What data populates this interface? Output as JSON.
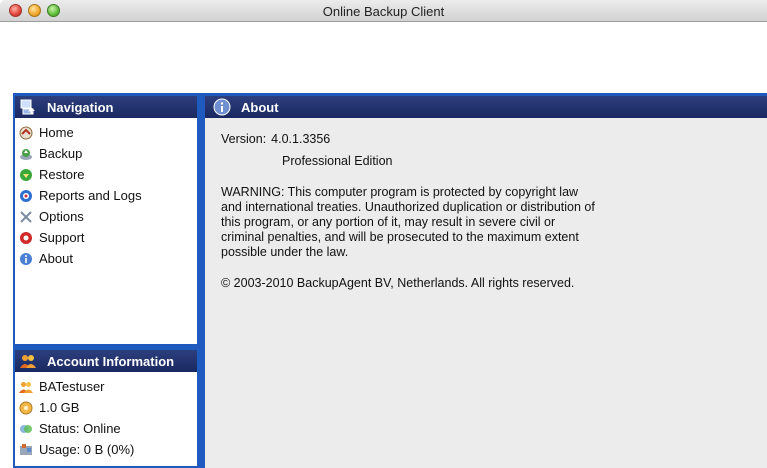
{
  "window": {
    "title": "Online Backup Client"
  },
  "navigation": {
    "header": "Navigation",
    "items": [
      {
        "label": "Home",
        "icon": "home-icon"
      },
      {
        "label": "Backup",
        "icon": "backup-icon"
      },
      {
        "label": "Restore",
        "icon": "restore-icon"
      },
      {
        "label": "Reports and Logs",
        "icon": "reports-icon"
      },
      {
        "label": "Options",
        "icon": "options-icon"
      },
      {
        "label": "Support",
        "icon": "support-icon"
      },
      {
        "label": "About",
        "icon": "info-icon"
      }
    ]
  },
  "account": {
    "header": "Account Information",
    "username": "BATestuser",
    "quota": "1.0 GB",
    "status": "Status: Online",
    "usage": "Usage: 0 B (0%)"
  },
  "about": {
    "header": "About",
    "version_label": "Version:",
    "version_value": "4.0.1.3356",
    "edition": "Professional Edition",
    "warning_lines": [
      "WARNING: This computer program is protected by copyright law",
      "and international treaties. Unauthorized duplication or distribution of",
      "this program, or any portion of it, may result in severe civil or",
      "criminal penalties, and will be prosecuted to the maximum extent",
      "possible under the law."
    ],
    "copyright": "© 2003-2010 BackupAgent BV, Netherlands. All rights reserved."
  },
  "colors": {
    "frame_blue": "#1f5bbf",
    "header_navy": "#1f2d66",
    "content_bg": "#ececec"
  }
}
